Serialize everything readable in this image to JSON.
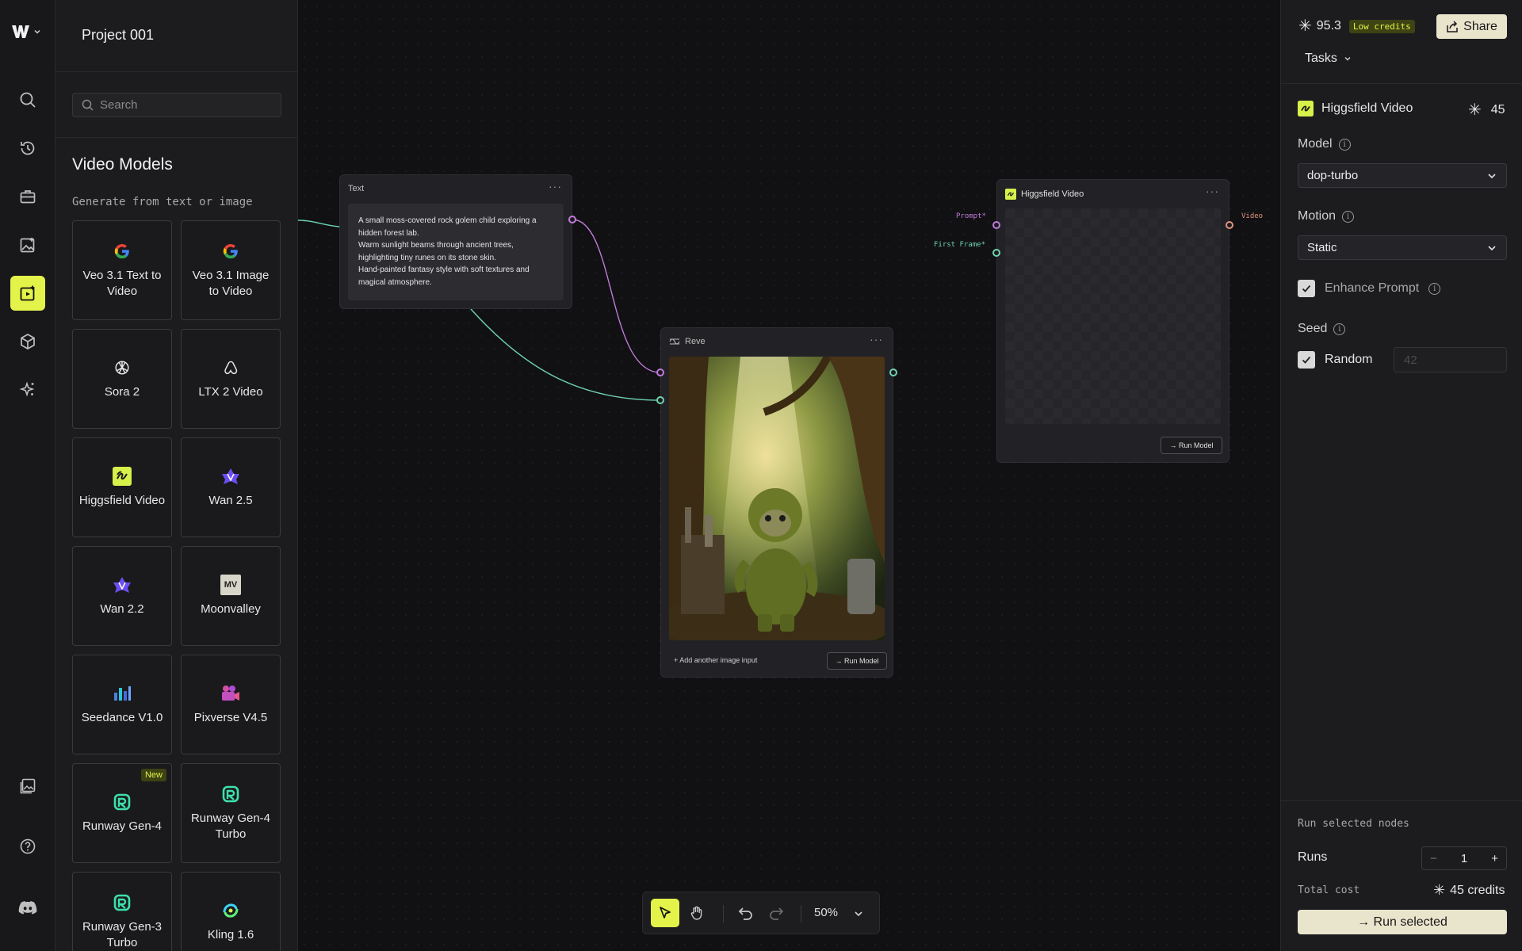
{
  "project": {
    "title": "Project 001"
  },
  "search": {
    "placeholder": "Search"
  },
  "models": {
    "heading": "Video Models",
    "subtitle": "Generate from text or image",
    "items": [
      {
        "label": "Veo 3.1 Text to Video",
        "icon": "google-icon"
      },
      {
        "label": "Veo 3.1 Image to Video",
        "icon": "google-icon"
      },
      {
        "label": "Sora 2",
        "icon": "openai-icon"
      },
      {
        "label": "LTX 2 Video",
        "icon": "ltx-icon"
      },
      {
        "label": "Higgsfield Video",
        "icon": "higgsfield-icon"
      },
      {
        "label": "Wan 2.5",
        "icon": "wan-icon"
      },
      {
        "label": "Wan 2.2",
        "icon": "wan-icon"
      },
      {
        "label": "Moonvalley",
        "icon": "moonvalley-icon",
        "icon_text": "MV"
      },
      {
        "label": "Seedance V1.0",
        "icon": "seedance-icon"
      },
      {
        "label": "Pixverse V4.5",
        "icon": "pixverse-icon"
      },
      {
        "label": "Runway Gen-4",
        "icon": "runway-icon",
        "badge": "New"
      },
      {
        "label": "Runway Gen-4 Turbo",
        "icon": "runway-icon"
      },
      {
        "label": "Runway Gen-3 Turbo",
        "icon": "runway-icon"
      },
      {
        "label": "Kling 1.6",
        "icon": "kling-icon"
      }
    ]
  },
  "canvas": {
    "text_node": {
      "title": "Text",
      "menu": "···",
      "body": "A small moss-covered rock golem child exploring a hidden forest lab.\nWarm sunlight beams through ancient trees, highlighting tiny runes on its stone skin.\nHand-painted fantasy style with soft textures and magical atmosphere."
    },
    "reve_node": {
      "title": "Reve",
      "menu": "···",
      "add_input": "+ Add another image input",
      "run": "→ Run Model"
    },
    "higgsfield_node": {
      "title": "Higgsfield Video",
      "menu": "···",
      "input_prompt": "Prompt*",
      "input_first_frame": "First Frame*",
      "output_video": "Video",
      "run": "→ Run Model"
    },
    "zoom": "50%"
  },
  "right_panel": {
    "credits": "95.3",
    "low_credits": "Low credits",
    "share": "Share",
    "tasks": "Tasks",
    "node_title": "Higgsfield Video",
    "node_cost": "45",
    "model_label": "Model",
    "model_value": "dop-turbo",
    "motion_label": "Motion",
    "motion_value": "Static",
    "enhance_label": "Enhance Prompt",
    "seed_label": "Seed",
    "random_label": "Random",
    "seed_placeholder": "42",
    "run_selected_title": "Run selected nodes",
    "runs_label": "Runs",
    "runs_value": "1",
    "runs_minus": "−",
    "runs_plus": "+",
    "total_cost_label": "Total cost",
    "total_cost_value": "45 credits",
    "run_selected_button": "→ Run selected"
  },
  "colors": {
    "accent": "#e3f34a",
    "cream": "#e9e4cc",
    "prompt_port": "#c07ad8",
    "image_port": "#6fd3b0",
    "video_port": "#e0927a"
  }
}
